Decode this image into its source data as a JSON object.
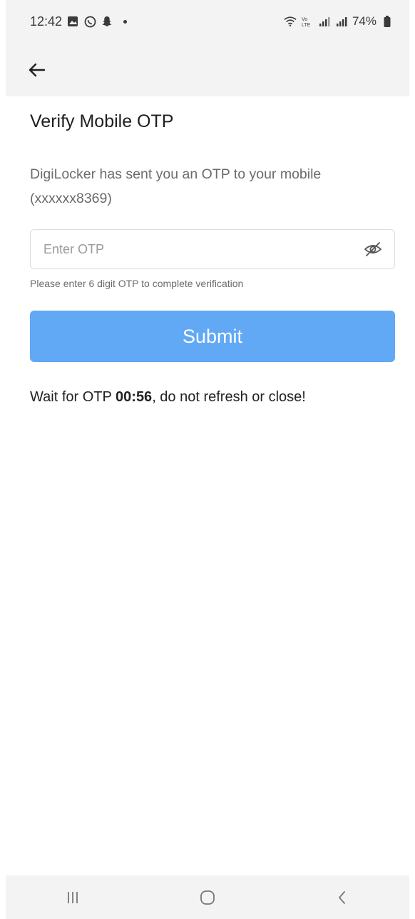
{
  "status_bar": {
    "time": "12:42",
    "left_icons": [
      "gallery-icon",
      "whatsapp-icon",
      "snapchat-icon"
    ],
    "battery_percent": "74%",
    "right_icons": [
      "wifi-icon",
      "volte-icon",
      "signal-icon",
      "signal-icon",
      "battery-icon"
    ]
  },
  "app_bar": {
    "back_icon": "back-arrow-icon"
  },
  "page": {
    "title": "Verify Mobile OTP",
    "description": "DigiLocker has sent you an OTP to your mobile (xxxxxx8369)"
  },
  "otp_field": {
    "placeholder": "Enter OTP",
    "value": "",
    "toggle_icon": "eye-off-icon"
  },
  "helper_text": "Please enter 6 digit OTP to complete verification",
  "submit": {
    "label": "Submit",
    "color": "#61a8f5"
  },
  "wait": {
    "prefix": "Wait for OTP ",
    "timer": "00:56",
    "suffix": ", do not refresh or close!"
  },
  "nav_bar": {
    "icons": [
      "recent-apps-icon",
      "home-icon",
      "back-icon"
    ]
  }
}
